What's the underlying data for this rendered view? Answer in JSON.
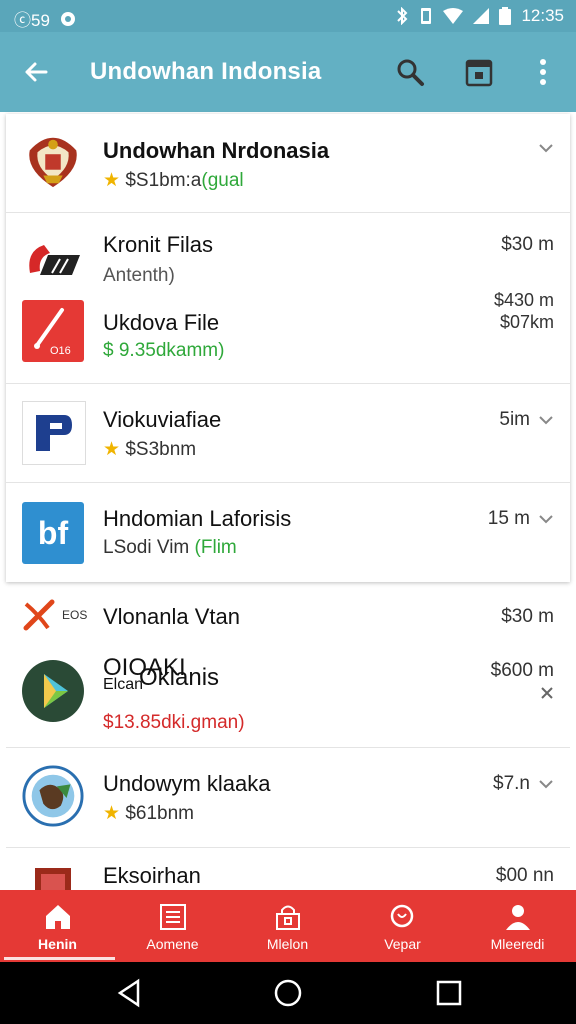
{
  "status_bar": {
    "time_left": "ⓒ59",
    "time_right": "12:35"
  },
  "app_bar": {
    "title": "Undowhan Indonsia"
  },
  "items": [
    {
      "title": "Undowhan Nrdonasia",
      "rating_text": "$S1bm:a",
      "rating_tail": "(gual",
      "meta": ""
    },
    {
      "title": "Kronit Filas",
      "subtitle": "Antenth)",
      "meta": "$30 m"
    },
    {
      "title": "Ukdova File",
      "subtitle": "$ 9.35dkamm)",
      "meta_top": "$430 m",
      "meta": "$07km",
      "icon_text": "O16"
    },
    {
      "title": "Viokuviafiae",
      "rating_text": "$S3bnm",
      "meta": "5im"
    },
    {
      "title": "Hndomian Laforisis",
      "subtitle_a": "LSodi Vim",
      "subtitle_b": "(Flim",
      "meta": "15 m",
      "icon_text": "bf"
    },
    {
      "title": "Vlonanla Vtan",
      "icon_text": "EOS",
      "meta": "$30 m"
    },
    {
      "title_a": "OIOAKI",
      "title_b": "Oklanis",
      "overlap": "Elcan",
      "subtitle": "$13.85dki.gman)",
      "meta": "$600 m"
    },
    {
      "title": "Undowym klaaka",
      "rating_text": "$61bnm",
      "meta": "$7.n"
    },
    {
      "title": "Eksoirhan",
      "meta": "$00 nn"
    }
  ],
  "bottom_nav": [
    {
      "label": "Henin",
      "icon": "home-icon"
    },
    {
      "label": "Aomene",
      "icon": "list-icon"
    },
    {
      "label": "Mlelon",
      "icon": "bag-icon"
    },
    {
      "label": "Vepar",
      "icon": "search-icon"
    },
    {
      "label": "Mleeredi",
      "icon": "person-icon"
    }
  ],
  "colors": {
    "app_bar": "#63b0c3",
    "status_bar": "#5aa6ba",
    "bottom_nav": "#e53935",
    "green": "#2fa83a",
    "red": "#d42a2a",
    "blue_price": "#3a78a8",
    "star": "#f0b400"
  }
}
